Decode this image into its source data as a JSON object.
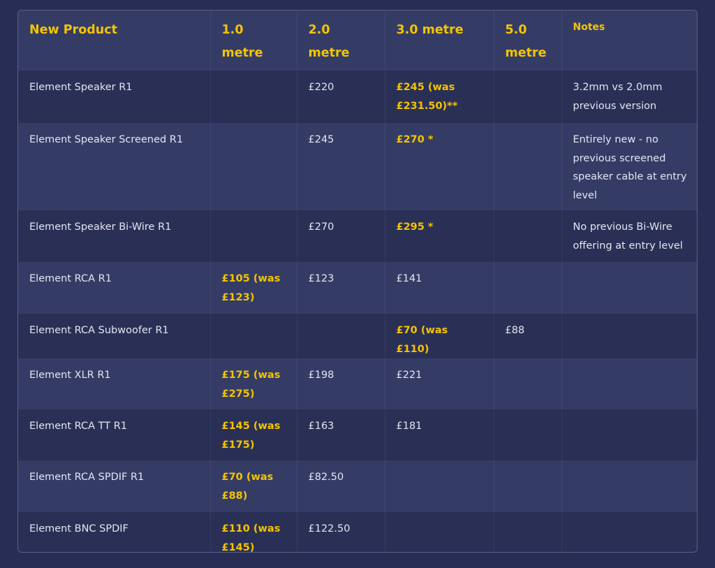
{
  "table": {
    "headers": [
      "New Product",
      "1.0 metre",
      "2.0 metre",
      "3.0 metre",
      "5.0 metre",
      "Notes"
    ],
    "rows": [
      {
        "product": "Element Speaker R1",
        "m1": "",
        "m2": "£220",
        "m3": "£245 (was £231.50)**",
        "m5": "",
        "notes": "3.2mm vs 2.0mm previous version"
      },
      {
        "product": "Element Speaker Screened R1",
        "m1": "",
        "m2": "£245",
        "m3": "£270 *",
        "m5": "",
        "notes": "Entirely new - no previous screened speaker cable at entry level"
      },
      {
        "product": "Element Speaker Bi-Wire R1",
        "m1": "",
        "m2": "£270",
        "m3": "£295 *",
        "m5": "",
        "notes": "No previous Bi-Wire offering at entry level"
      },
      {
        "product": "Element RCA R1",
        "m1": "£105 (was £123)",
        "m2": "£123",
        "m3": "£141",
        "m5": "",
        "notes": ""
      },
      {
        "product": "Element RCA Subwoofer R1",
        "m1": "",
        "m2": "",
        "m3": "£70 (was £110)",
        "m5": "£88",
        "notes": ""
      },
      {
        "product": "Element XLR R1",
        "m1": "£175 (was £275)",
        "m2": "£198",
        "m3": "£221",
        "m5": "",
        "notes": ""
      },
      {
        "product": "Element RCA TT R1",
        "m1": "£145 (was £175)",
        "m2": "£163",
        "m3": "£181",
        "m5": "",
        "notes": ""
      },
      {
        "product": "Element RCA SPDIF R1",
        "m1": "£70 (was £88)",
        "m2": "£82.50",
        "m3": "",
        "m5": "",
        "notes": ""
      },
      {
        "product": "Element BNC SPDIF",
        "m1": "£110 (was £145)",
        "m2": "£122.50",
        "m3": "",
        "m5": "",
        "notes": ""
      }
    ]
  },
  "colors": {
    "page_background": "#272d55",
    "header_text": "#f5c400",
    "highlight_text": "#f5c400",
    "body_text": "#e3e6f2",
    "row_dark": "#2a3055",
    "row_light": "#343c66"
  }
}
